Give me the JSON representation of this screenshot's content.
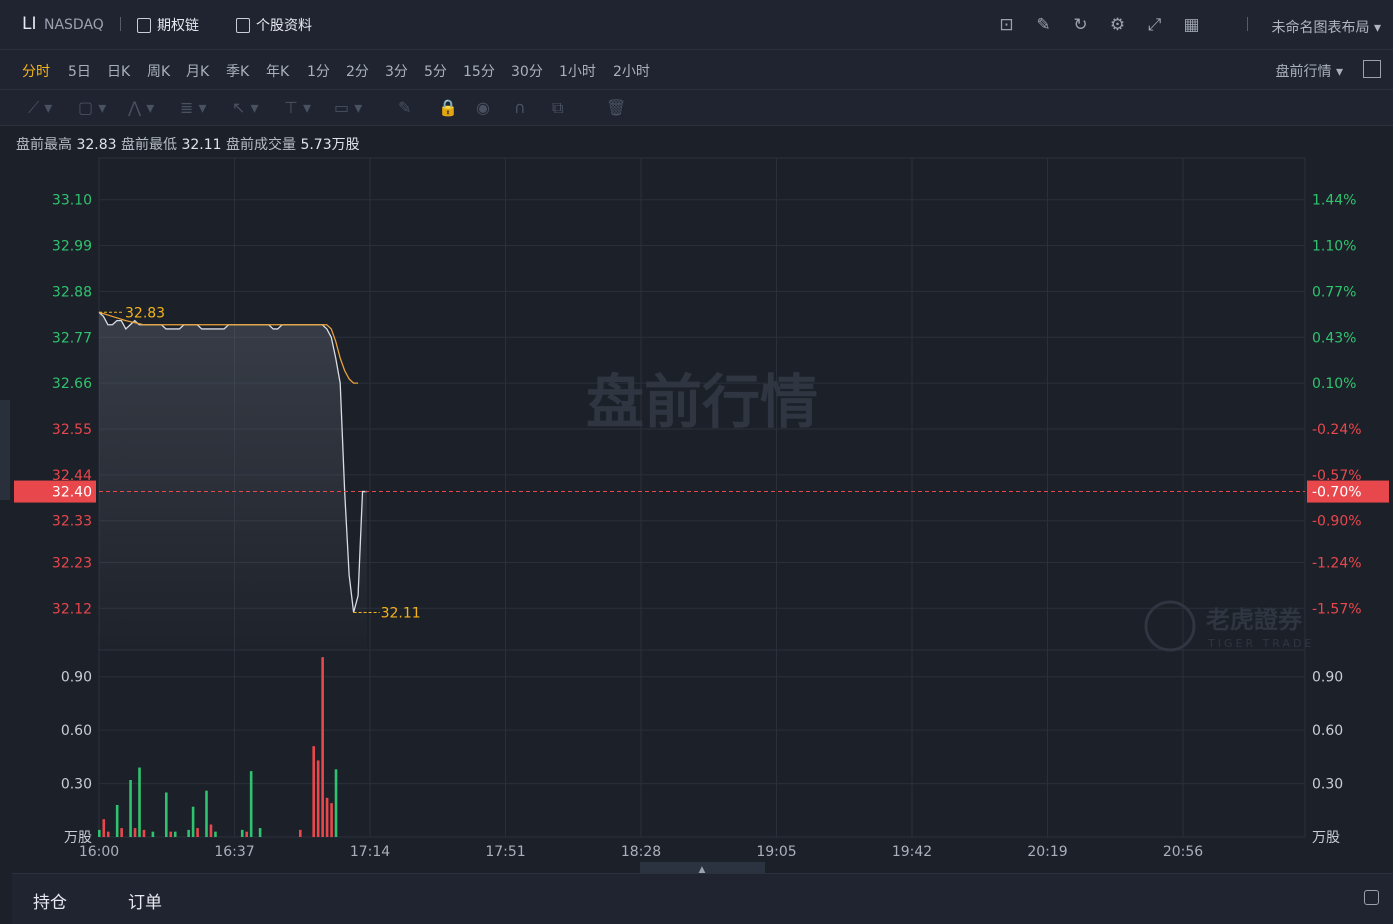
{
  "header": {
    "symbol": "LI",
    "exchange": "NASDAQ",
    "option_chain": "期权链",
    "stock_info": "个股资料",
    "layout_name": "未命名图表布局"
  },
  "periods": [
    "分时",
    "5日",
    "日K",
    "周K",
    "月K",
    "季K",
    "年K",
    "1分",
    "2分",
    "3分",
    "5分",
    "15分",
    "30分",
    "1小时",
    "2小时"
  ],
  "active_period": "分时",
  "session_select": "盘前行情",
  "stats": {
    "high_label": "盘前最高",
    "high": "32.83",
    "low_label": "盘前最低",
    "low": "32.11",
    "vol_label": "盘前成交量",
    "vol": "5.73万股"
  },
  "watermark": "盘前行情",
  "brand": {
    "name": "老虎證券",
    "sub": "TIGER TRADE"
  },
  "colors": {
    "up": "#e8474c",
    "down": "#2fc36f",
    "accent": "#f5b41b",
    "price_line": "#d8dce3",
    "avg_line": "#e8a23a"
  },
  "chart_data": {
    "type": "line",
    "price_axis_left": [
      "33.10",
      "32.99",
      "32.88",
      "32.77",
      "32.66",
      "32.55",
      "32.44",
      "32.33",
      "32.23",
      "32.12"
    ],
    "price_axis_right": [
      "1.44%",
      "1.10%",
      "0.77%",
      "0.43%",
      "0.10%",
      "-0.24%",
      "-0.57%",
      "-0.90%",
      "-1.24%",
      "-1.57%"
    ],
    "price_ticks": [
      33.1,
      32.99,
      32.88,
      32.77,
      32.66,
      32.55,
      32.44,
      32.33,
      32.23,
      32.12
    ],
    "ylim": [
      32.02,
      33.2
    ],
    "current_price": "32.40",
    "current_pct": "-0.70%",
    "current_value": 32.4,
    "high_marker": "32.83",
    "high_value": 32.83,
    "low_marker": "32.11",
    "low_value": 32.11,
    "time_labels": [
      "16:00",
      "16:37",
      "17:14",
      "17:51",
      "18:28",
      "19:05",
      "19:42",
      "20:19",
      "20:56"
    ],
    "minutes_total": 270,
    "price_series": [
      [
        0,
        32.83
      ],
      [
        1,
        32.82
      ],
      [
        2,
        32.8
      ],
      [
        3,
        32.8
      ],
      [
        4,
        32.81
      ],
      [
        5,
        32.81
      ],
      [
        6,
        32.79
      ],
      [
        7,
        32.8
      ],
      [
        8,
        32.81
      ],
      [
        9,
        32.8
      ],
      [
        10,
        32.8
      ],
      [
        11,
        32.8
      ],
      [
        12,
        32.8
      ],
      [
        14,
        32.8
      ],
      [
        15,
        32.79
      ],
      [
        18,
        32.79
      ],
      [
        19,
        32.8
      ],
      [
        22,
        32.8
      ],
      [
        23,
        32.79
      ],
      [
        28,
        32.79
      ],
      [
        29,
        32.8
      ],
      [
        38,
        32.8
      ],
      [
        39,
        32.79
      ],
      [
        40,
        32.79
      ],
      [
        41,
        32.8
      ],
      [
        50,
        32.8
      ],
      [
        51,
        32.79
      ],
      [
        52,
        32.77
      ],
      [
        53,
        32.72
      ],
      [
        54,
        32.66
      ],
      [
        55,
        32.4
      ],
      [
        56,
        32.2
      ],
      [
        57,
        32.11
      ],
      [
        58,
        32.15
      ],
      [
        59,
        32.4
      ],
      [
        60,
        32.4
      ]
    ],
    "avg_series": [
      [
        0,
        32.83
      ],
      [
        3,
        32.82
      ],
      [
        6,
        32.81
      ],
      [
        10,
        32.8
      ],
      [
        20,
        32.8
      ],
      [
        30,
        32.8
      ],
      [
        45,
        32.8
      ],
      [
        50,
        32.8
      ],
      [
        51,
        32.8
      ],
      [
        52,
        32.79
      ],
      [
        53,
        32.76
      ],
      [
        54,
        32.72
      ],
      [
        55,
        32.69
      ],
      [
        56,
        32.67
      ],
      [
        57,
        32.66
      ],
      [
        58,
        32.66
      ]
    ],
    "volume_axis": [
      "0.90",
      "0.60",
      "0.30"
    ],
    "volume_ticks": [
      0.9,
      0.6,
      0.3
    ],
    "volume_unit": "万股",
    "volume_max": 1.05,
    "volumes": [
      [
        0,
        0.04,
        "d"
      ],
      [
        1,
        0.1,
        "u"
      ],
      [
        2,
        0.03,
        "u"
      ],
      [
        4,
        0.18,
        "d"
      ],
      [
        5,
        0.05,
        "u"
      ],
      [
        7,
        0.32,
        "d"
      ],
      [
        8,
        0.05,
        "u"
      ],
      [
        9,
        0.39,
        "d"
      ],
      [
        10,
        0.04,
        "u"
      ],
      [
        12,
        0.03,
        "d"
      ],
      [
        15,
        0.25,
        "d"
      ],
      [
        16,
        0.03,
        "u"
      ],
      [
        17,
        0.03,
        "d"
      ],
      [
        20,
        0.04,
        "d"
      ],
      [
        21,
        0.17,
        "d"
      ],
      [
        22,
        0.05,
        "u"
      ],
      [
        24,
        0.26,
        "d"
      ],
      [
        25,
        0.07,
        "u"
      ],
      [
        26,
        0.03,
        "d"
      ],
      [
        32,
        0.04,
        "d"
      ],
      [
        33,
        0.03,
        "u"
      ],
      [
        34,
        0.37,
        "d"
      ],
      [
        36,
        0.05,
        "d"
      ],
      [
        45,
        0.04,
        "u"
      ],
      [
        48,
        0.51,
        "u"
      ],
      [
        49,
        0.43,
        "u"
      ],
      [
        50,
        1.01,
        "u"
      ],
      [
        51,
        0.22,
        "u"
      ],
      [
        52,
        0.19,
        "u"
      ],
      [
        53,
        0.38,
        "d"
      ]
    ]
  },
  "bottom_tabs": [
    "持仓",
    "订单"
  ]
}
